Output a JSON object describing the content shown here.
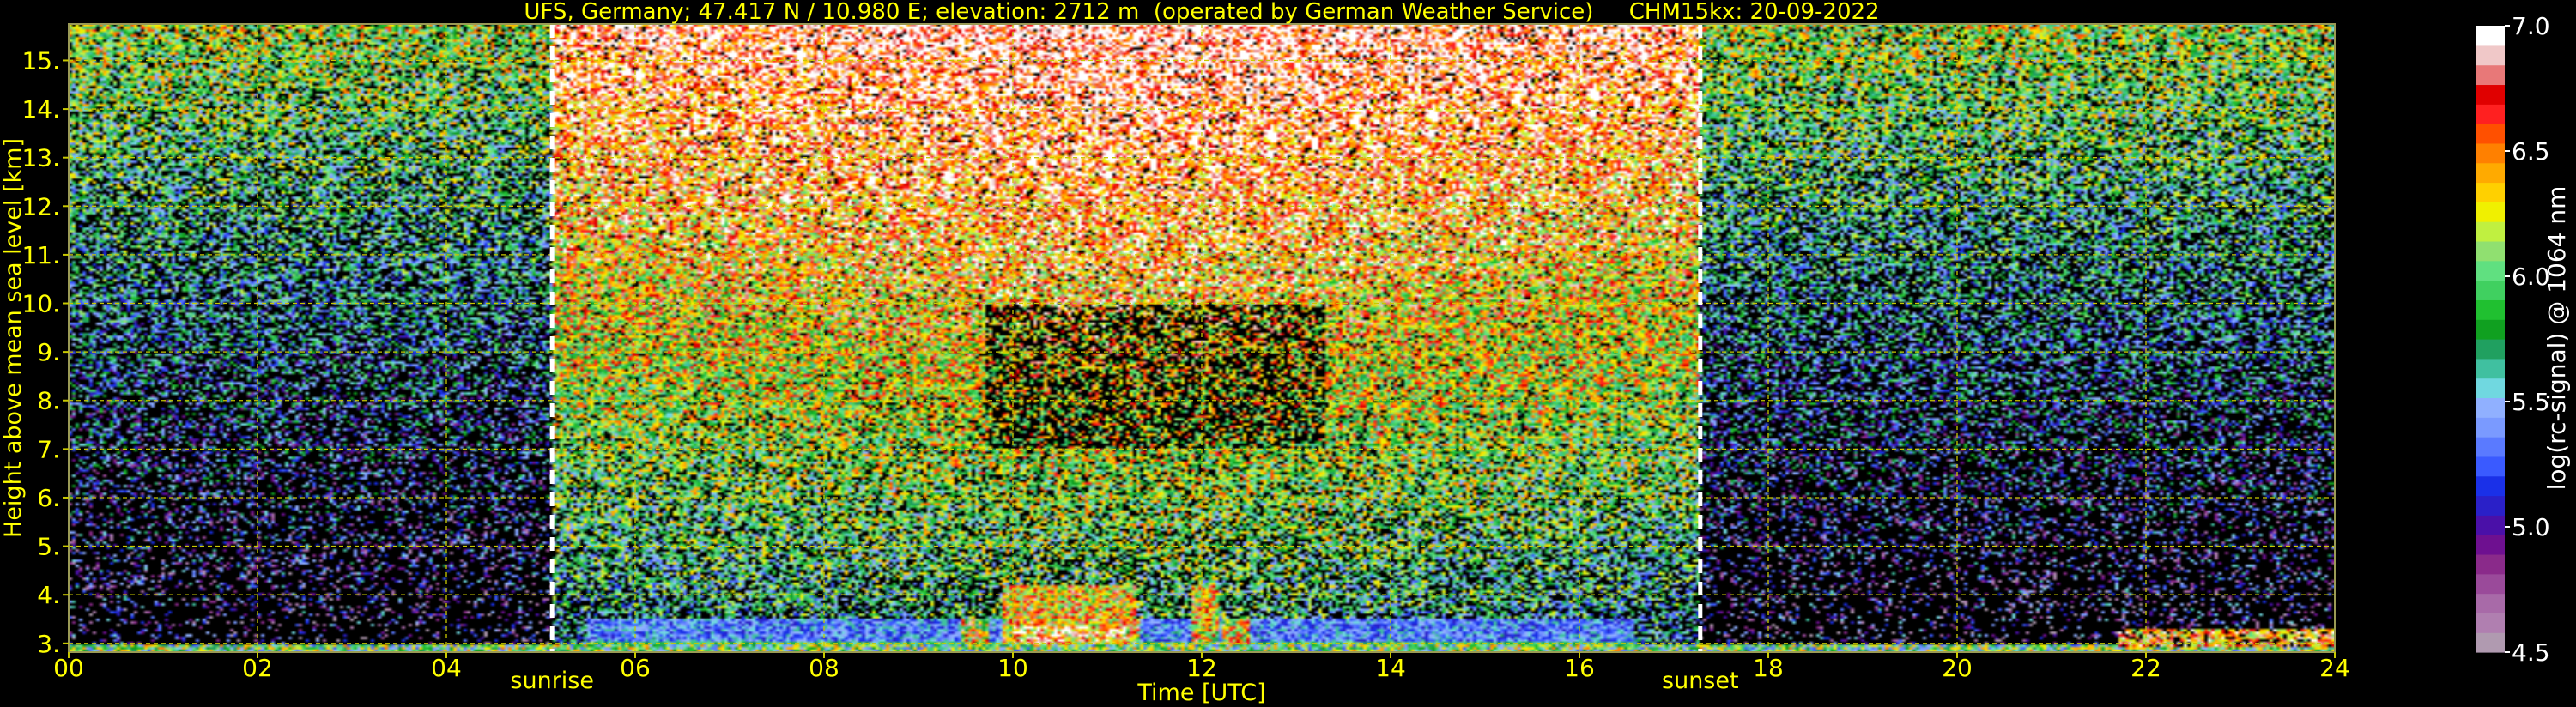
{
  "chart_data": {
    "type": "heatmap",
    "title": "UFS, Germany; 47.417 N / 10.980 E; elevation: 2712 m  (operated by German Weather Service)     CHM15kx: 20-09-2022",
    "xlabel": "Time [UTC]",
    "ylabel": "Height above mean sea level [km]",
    "xlim": [
      0,
      24
    ],
    "ylim": [
      2.82,
      15.75
    ],
    "x_ticks": [
      "00",
      "02",
      "04",
      "06",
      "08",
      "10",
      "12",
      "14",
      "16",
      "18",
      "20",
      "22",
      "24"
    ],
    "y_ticks": [
      "3.",
      "4.",
      "5.",
      "6.",
      "7.",
      "8.",
      "9.",
      "10.",
      "11.",
      "12.",
      "13.",
      "14.",
      "15."
    ],
    "grid": true,
    "markers": [
      {
        "label": "sunrise",
        "time": 5.12
      },
      {
        "label": "sunset",
        "time": 17.28
      }
    ],
    "colorbar": {
      "label": "log(rc-signal) @ 1064 nm",
      "min": 4.5,
      "max": 7.0,
      "ticks": [
        "4.5",
        "5.0",
        "5.5",
        "6.0",
        "6.5",
        "7.0"
      ],
      "colors": [
        "#b09ab0",
        "#b07fb0",
        "#a86aa8",
        "#9a4a9a",
        "#8a2a8a",
        "#6e1090",
        "#4a10a8",
        "#2a20c8",
        "#1a30e8",
        "#3a5aff",
        "#5a7aff",
        "#7a9aff",
        "#90b0ff",
        "#70d8e0",
        "#40c0a0",
        "#20a060",
        "#10a020",
        "#20c030",
        "#40d060",
        "#60e080",
        "#90e070",
        "#c0f040",
        "#f0f000",
        "#ffd000",
        "#ffaa00",
        "#ff8000",
        "#ff5000",
        "#ff2020",
        "#e00000",
        "#e87878",
        "#f0c8c8",
        "#ffffff"
      ]
    },
    "features": [
      {
        "name": "boundary-layer signal",
        "from": 5.5,
        "to": 16.6,
        "top_km": 3.5
      },
      {
        "name": "cloud echoes",
        "from": 9.3,
        "to": 13.4,
        "top_km": 4.2
      },
      {
        "name": "low cloud",
        "from": 21.7,
        "to": 24.0,
        "top_km": 3.3
      }
    ]
  }
}
